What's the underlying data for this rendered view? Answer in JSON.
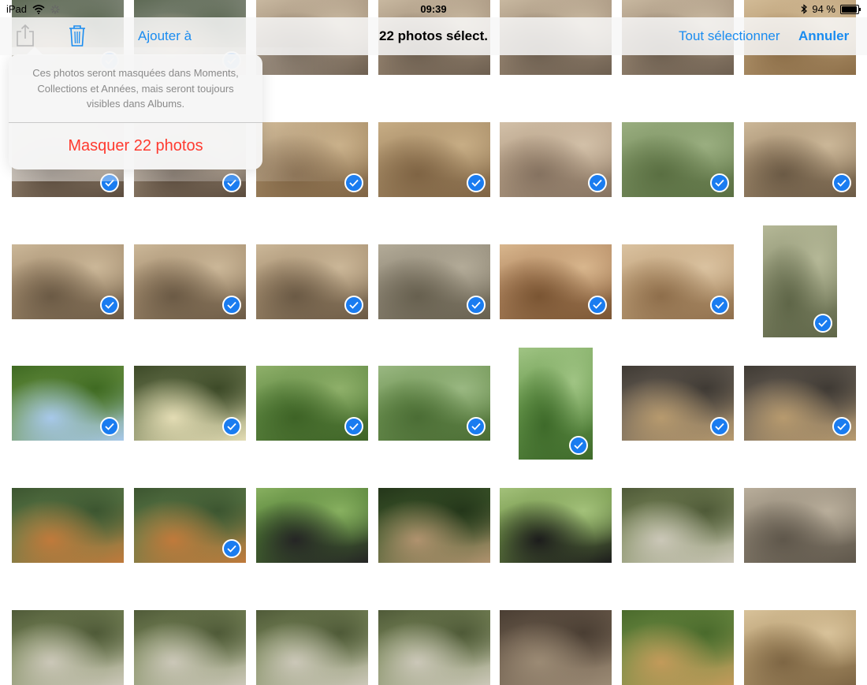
{
  "status_bar": {
    "device": "iPad",
    "time": "09:39",
    "battery_percent": "94 %",
    "battery_level": 0.94,
    "icons": [
      "wifi-icon",
      "activity-spinner-icon",
      "bluetooth-icon",
      "battery-icon"
    ]
  },
  "toolbar": {
    "title": "22 photos sélect.",
    "add_to_label": "Ajouter à",
    "select_all_label": "Tout sélectionner",
    "cancel_label": "Annuler",
    "icons": [
      "share-icon",
      "trash-icon"
    ]
  },
  "popover": {
    "message": "Ces photos seront masquées dans Moments, Collections et Années, mais seront toujours visibles dans Albums.",
    "action_label": "Masquer 22 photos"
  },
  "colors": {
    "accent": "#1a8cf0",
    "destructive": "#ff3b30",
    "check": "#1a7cf0"
  },
  "photos": [
    {
      "subject": "zoo-scene",
      "selected": true
    },
    {
      "subject": "zoo-scene",
      "selected": true
    },
    {
      "subject": "zoo-visitors",
      "selected": false
    },
    {
      "subject": "zoo-visitors",
      "selected": false
    },
    {
      "subject": "zoo-visitors",
      "selected": false
    },
    {
      "subject": "zoo-visitors",
      "selected": false
    },
    {
      "subject": "animal",
      "selected": false
    },
    {
      "subject": "children-at-zoo",
      "selected": true
    },
    {
      "subject": "children-at-zoo",
      "selected": true
    },
    {
      "subject": "rock-arch",
      "selected": true
    },
    {
      "subject": "rock-arch",
      "selected": true
    },
    {
      "subject": "rhino",
      "selected": true
    },
    {
      "subject": "guinea-fowl",
      "selected": true
    },
    {
      "subject": "children-with-goat",
      "selected": true
    },
    {
      "subject": "children-with-goat",
      "selected": true
    },
    {
      "subject": "children-with-goat",
      "selected": true
    },
    {
      "subject": "children-with-goat",
      "selected": true
    },
    {
      "subject": "goat",
      "selected": true
    },
    {
      "subject": "ram",
      "selected": true
    },
    {
      "subject": "tortoise",
      "selected": true
    },
    {
      "subject": "children-with-statue",
      "selected": true
    },
    {
      "subject": "tree-sky",
      "selected": true
    },
    {
      "subject": "yucca-flowers",
      "selected": true
    },
    {
      "subject": "forest",
      "selected": true
    },
    {
      "subject": "rope-bridge",
      "selected": true
    },
    {
      "subject": "gibbon-on-ropes",
      "selected": true
    },
    {
      "subject": "gibbons",
      "selected": true
    },
    {
      "subject": "gibbons",
      "selected": true
    },
    {
      "subject": "tiger",
      "selected": false
    },
    {
      "subject": "tiger",
      "selected": true
    },
    {
      "subject": "gibbon",
      "selected": false
    },
    {
      "subject": "forest-path",
      "selected": false
    },
    {
      "subject": "lemurs",
      "selected": false
    },
    {
      "subject": "vulture",
      "selected": false
    },
    {
      "subject": "visitors-at-enclosure",
      "selected": false
    },
    {
      "subject": "vulture",
      "selected": false
    },
    {
      "subject": "vulture",
      "selected": false
    },
    {
      "subject": "vulture",
      "selected": false
    },
    {
      "subject": "vulture",
      "selected": false
    },
    {
      "subject": "enclosure",
      "selected": false
    },
    {
      "subject": "deer",
      "selected": false
    },
    {
      "subject": "lion",
      "selected": false
    }
  ]
}
